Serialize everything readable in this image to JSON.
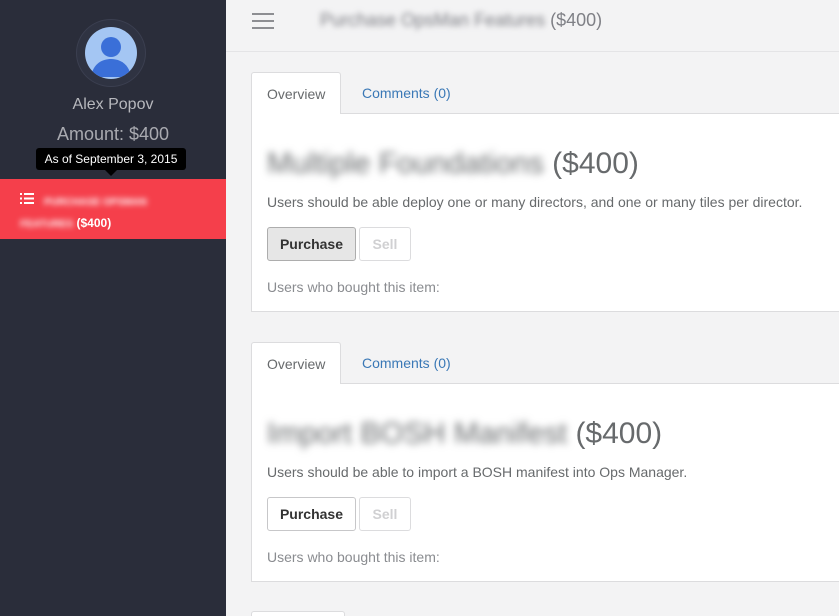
{
  "sidebar": {
    "user_name": "Alex Popov",
    "amount": "Amount: $400",
    "tooltip": "As of September 3, 2015",
    "nav_item": {
      "blurred_label_line1": "Purchase OpsMan",
      "blurred_label_line2": "Features",
      "price": "($400)"
    },
    "colors": {
      "background": "#2a2d3a",
      "active": "#f53f4b"
    }
  },
  "header": {
    "title_blurred": "Purchase OpsMan Features",
    "title_price": "($400)",
    "menu_icon": "hamburger-icon"
  },
  "items": [
    {
      "tabs": {
        "overview": "Overview",
        "comments": "Comments (0)"
      },
      "title_blurred": "Multiple Foundations",
      "price": "($400)",
      "description": "Users should be able deploy one or many directors, and one or many tiles per director.",
      "purchase_label": "Purchase",
      "sell_label": "Sell",
      "bought_label": "Users who bought this item:"
    },
    {
      "tabs": {
        "overview": "Overview",
        "comments": "Comments (0)"
      },
      "title_blurred": "Import BOSH Manifest",
      "price": "($400)",
      "description": "Users should be able to import a BOSH manifest into Ops Manager.",
      "purchase_label": "Purchase",
      "sell_label": "Sell",
      "bought_label": "Users who bought this item:"
    }
  ]
}
